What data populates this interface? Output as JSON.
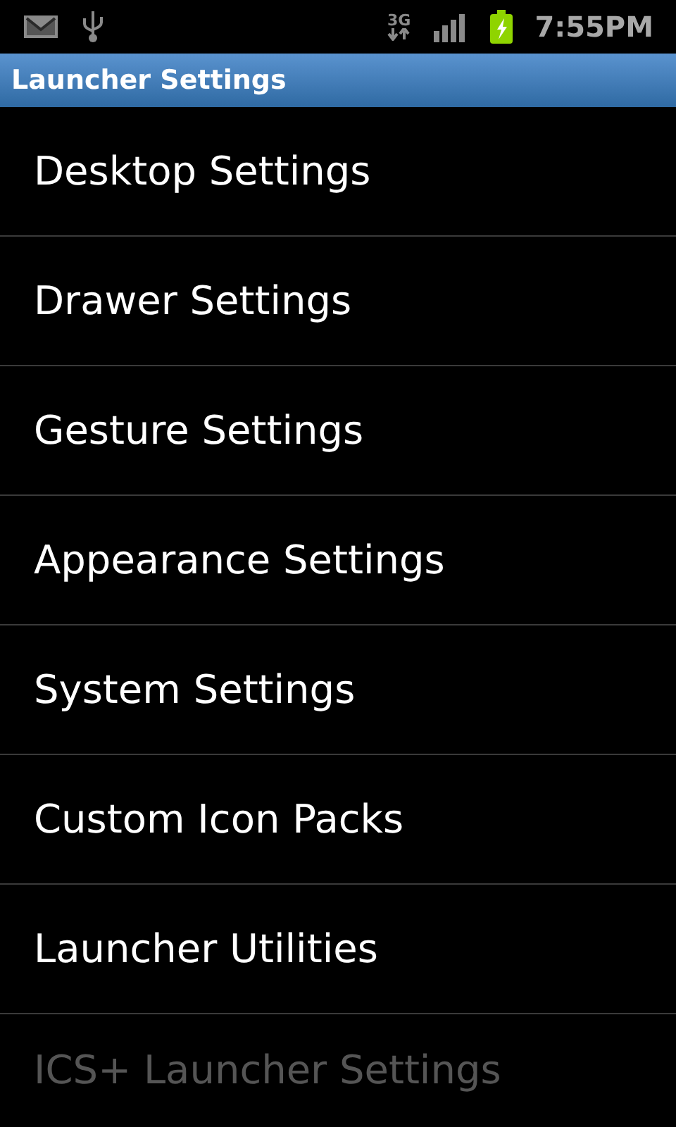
{
  "status_bar": {
    "time": "7:55PM",
    "network": "3G"
  },
  "window": {
    "title": "Launcher Settings"
  },
  "items": [
    {
      "label": "Desktop Settings",
      "disabled": false
    },
    {
      "label": "Drawer Settings",
      "disabled": false
    },
    {
      "label": "Gesture Settings",
      "disabled": false
    },
    {
      "label": "Appearance Settings",
      "disabled": false
    },
    {
      "label": "System Settings",
      "disabled": false
    },
    {
      "label": "Custom Icon Packs",
      "disabled": false
    },
    {
      "label": "Launcher Utilities",
      "disabled": false
    },
    {
      "label": "ICS+ Launcher Settings",
      "disabled": true
    }
  ]
}
